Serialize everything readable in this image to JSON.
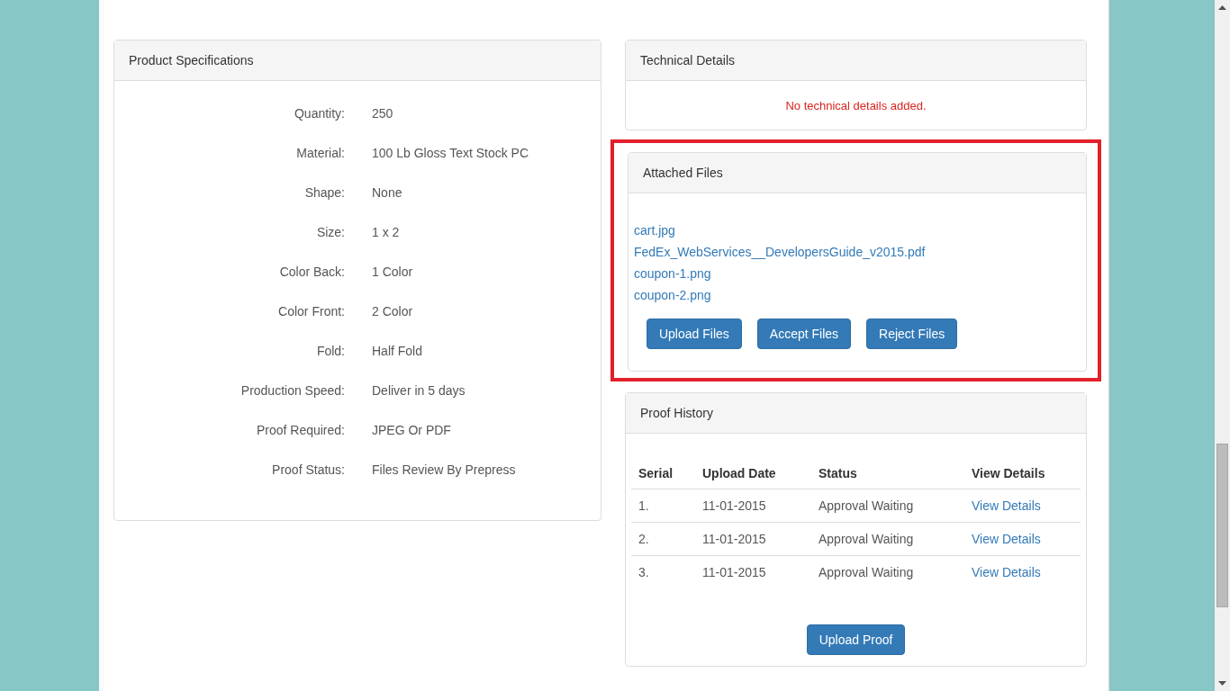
{
  "product_specifications": {
    "title": "Product Specifications",
    "rows": [
      {
        "label": "Quantity:",
        "value": "250"
      },
      {
        "label": "Material:",
        "value": "100 Lb Gloss Text Stock PC"
      },
      {
        "label": "Shape:",
        "value": "None"
      },
      {
        "label": "Size:",
        "value": "1 x 2"
      },
      {
        "label": "Color Back:",
        "value": "1 Color"
      },
      {
        "label": "Color Front:",
        "value": "2 Color"
      },
      {
        "label": "Fold:",
        "value": "Half Fold"
      },
      {
        "label": "Production Speed:",
        "value": "Deliver in 5 days"
      },
      {
        "label": "Proof Required:",
        "value": "JPEG Or PDF"
      },
      {
        "label": "Proof Status:",
        "value": "Files Review By Prepress"
      }
    ]
  },
  "technical_details": {
    "title": "Technical Details",
    "message": "No technical details added."
  },
  "attached_files": {
    "title": "Attached Files",
    "highlighted": true,
    "files": [
      "cart.jpg",
      "FedEx_WebServices__DevelopersGuide_v2015.pdf",
      "coupon-1.png",
      "coupon-2.png"
    ],
    "buttons": [
      "Upload Files",
      "Accept Files",
      "Reject Files"
    ]
  },
  "proof_history": {
    "title": "Proof History",
    "columns": [
      "Serial",
      "Upload Date",
      "Status",
      "View Details"
    ],
    "rows": [
      {
        "serial": "1.",
        "upload_date": "11-01-2015",
        "status": "Approval Waiting",
        "link": "View Details"
      },
      {
        "serial": "2.",
        "upload_date": "11-01-2015",
        "status": "Approval Waiting",
        "link": "View Details"
      },
      {
        "serial": "3.",
        "upload_date": "11-01-2015",
        "status": "Approval Waiting",
        "link": "View Details"
      }
    ],
    "button": "Upload Proof"
  }
}
